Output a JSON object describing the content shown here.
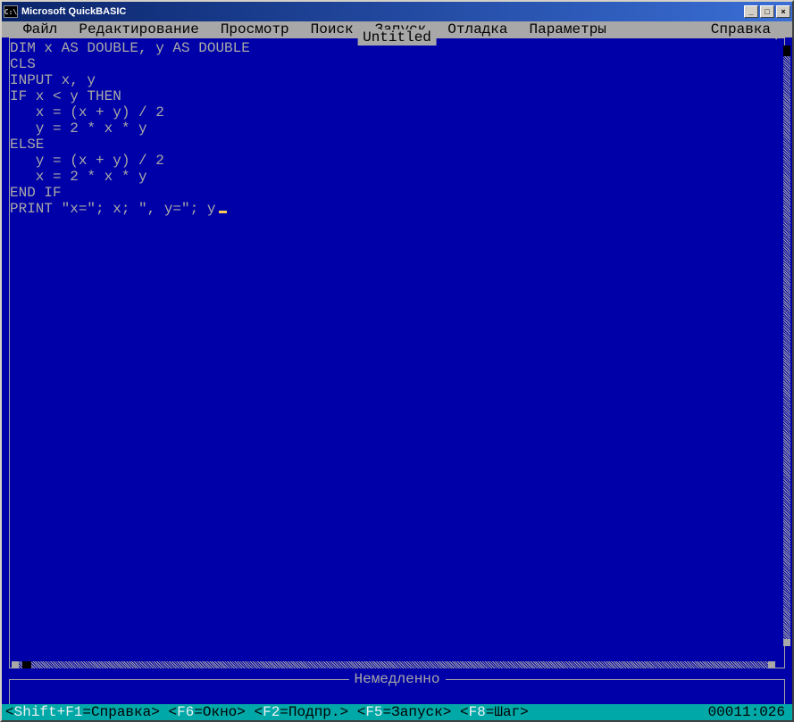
{
  "titlebar": {
    "icon_text": "C:\\",
    "title": "Microsoft QuickBASIC"
  },
  "menubar": {
    "items": [
      "Файл",
      "Редактирование",
      "Просмотр",
      "Поиск",
      "Запуск",
      "Отладка",
      "Параметры",
      "Справка"
    ]
  },
  "editor": {
    "title": "Untitled",
    "code_lines": [
      "DIM x AS DOUBLE, y AS DOUBLE",
      "CLS",
      "INPUT x, y",
      "IF x < y THEN",
      "   x = (x + y) / 2",
      "   y = 2 * x * y",
      "ELSE",
      "   y = (x + y) / 2",
      "   x = 2 * x * y",
      "END IF",
      "PRINT \"x=\"; x; \", y=\"; y"
    ]
  },
  "immediate": {
    "title": "Немедленно"
  },
  "statusbar": {
    "hints": [
      {
        "key": "Shift+F1",
        "label": "Справка"
      },
      {
        "key": "F6",
        "label": "Окно"
      },
      {
        "key": "F2",
        "label": "Подпр."
      },
      {
        "key": "F5",
        "label": "Запуск"
      },
      {
        "key": "F8",
        "label": "Шаг"
      }
    ],
    "position": "00011:026"
  }
}
